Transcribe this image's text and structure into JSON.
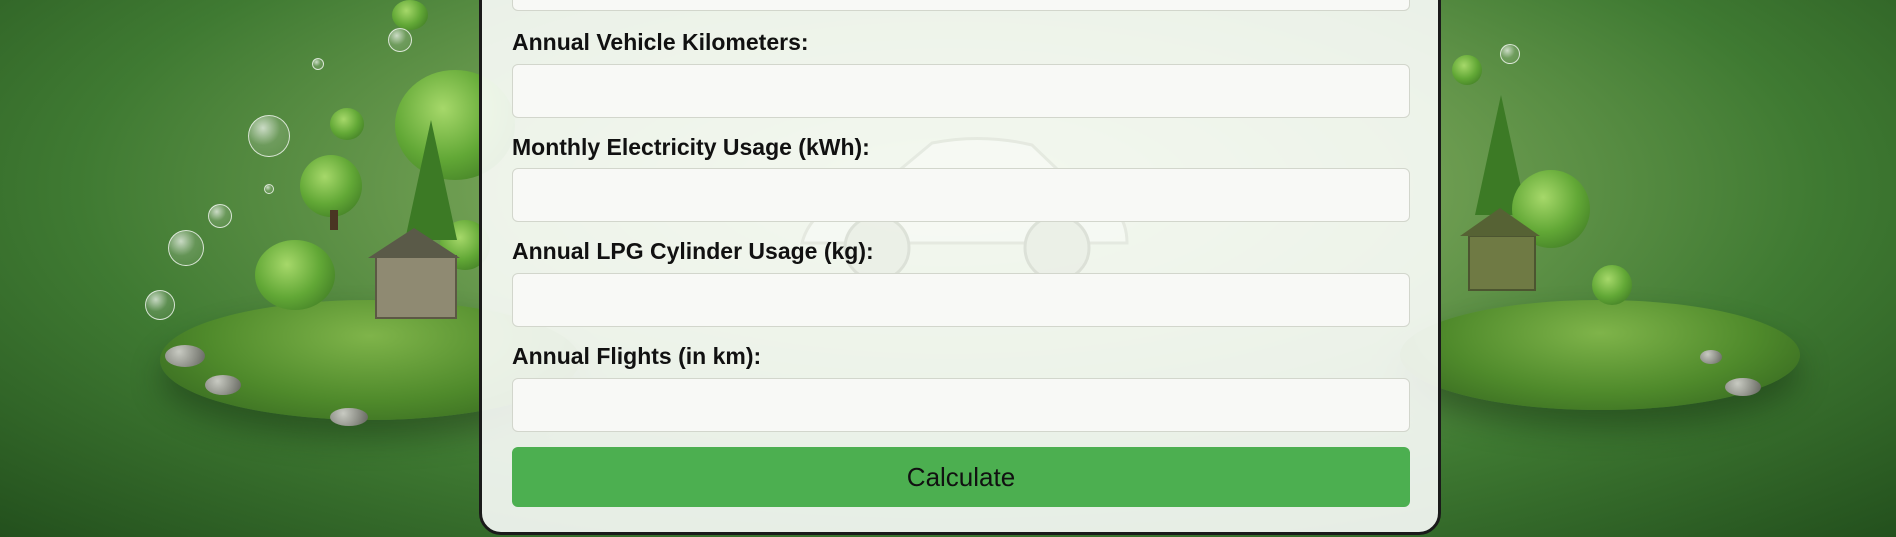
{
  "form": {
    "fields": [
      {
        "label": "Annual Vehicle Kilometers:",
        "value": "",
        "placeholder": ""
      },
      {
        "label": "Monthly Electricity Usage (kWh):",
        "value": "",
        "placeholder": ""
      },
      {
        "label": "Annual LPG Cylinder Usage (kg):",
        "value": "",
        "placeholder": ""
      },
      {
        "label": "Annual Flights (in km):",
        "value": "",
        "placeholder": ""
      }
    ],
    "submit_label": "Calculate"
  },
  "colors": {
    "button": "#4caf50",
    "background": "#5f9a45",
    "card_border": "#1a1a1a"
  }
}
